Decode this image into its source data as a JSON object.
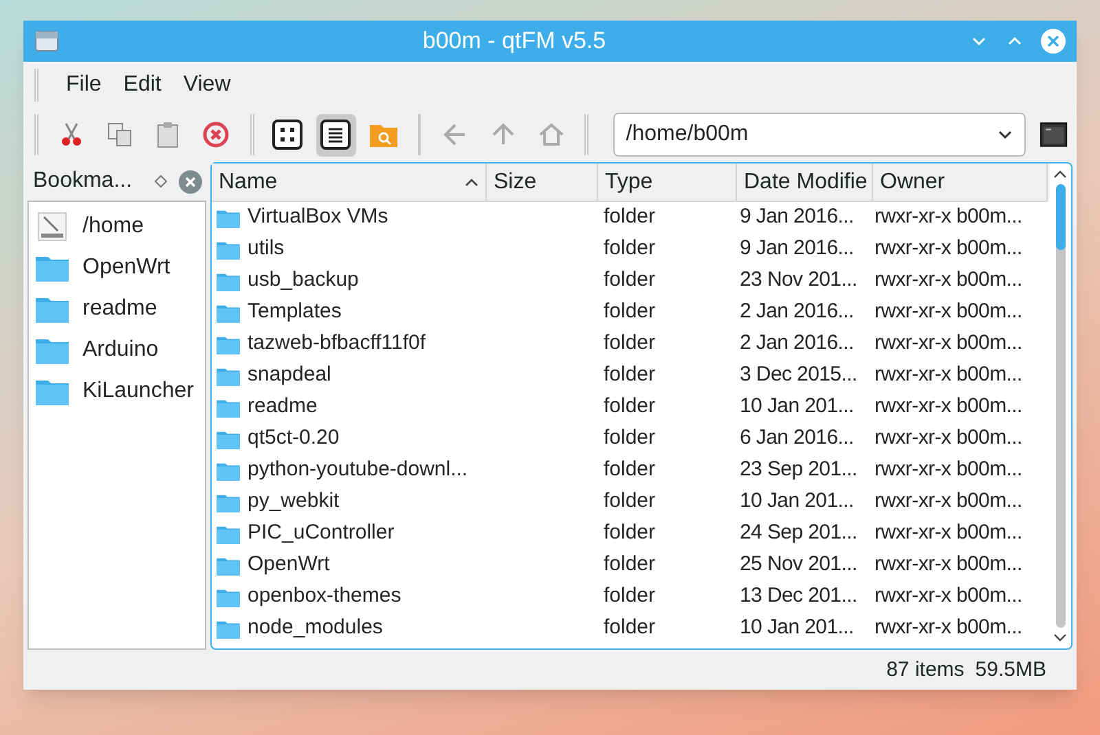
{
  "window": {
    "title": "b00m - qtFM v5.5"
  },
  "menu": [
    "File",
    "Edit",
    "View"
  ],
  "toolbar": [
    {
      "kind": "cut",
      "selected": false
    },
    {
      "kind": "copy",
      "selected": false
    },
    {
      "kind": "paste",
      "selected": false
    },
    {
      "kind": "delete",
      "selected": false
    },
    {
      "kind": "sep"
    },
    {
      "kind": "icons",
      "selected": false
    },
    {
      "kind": "details",
      "selected": true
    },
    {
      "kind": "search",
      "selected": false
    },
    {
      "kind": "sep"
    },
    {
      "kind": "back",
      "selected": false
    },
    {
      "kind": "up",
      "selected": false
    },
    {
      "kind": "home",
      "selected": false
    },
    {
      "kind": "sep"
    }
  ],
  "path": {
    "value": "/home/b00m"
  },
  "bookmarks": {
    "title": "Bookma...",
    "items": [
      {
        "label": "/home",
        "kind": "drive"
      },
      {
        "label": "OpenWrt",
        "kind": "folder"
      },
      {
        "label": "readme",
        "kind": "folder"
      },
      {
        "label": "Arduino",
        "kind": "folder"
      },
      {
        "label": "KiLauncher",
        "kind": "folder"
      }
    ]
  },
  "table": {
    "columns": [
      "Name",
      "Size",
      "Type",
      "Date Modifie",
      "Owner"
    ],
    "rows": [
      {
        "name": "VirtualBox VMs",
        "type": "folder",
        "date": "9 Jan 2016...",
        "owner": "rwxr-xr-x b00m..."
      },
      {
        "name": "utils",
        "type": "folder",
        "date": "9 Jan 2016...",
        "owner": "rwxr-xr-x b00m..."
      },
      {
        "name": "usb_backup",
        "type": "folder",
        "date": "23 Nov 201...",
        "owner": "rwxr-xr-x b00m..."
      },
      {
        "name": "Templates",
        "type": "folder",
        "date": "2 Jan 2016...",
        "owner": "rwxr-xr-x b00m..."
      },
      {
        "name": "tazweb-bfbacff11f0f",
        "type": "folder",
        "date": "2 Jan 2016...",
        "owner": "rwxr-xr-x b00m..."
      },
      {
        "name": "snapdeal",
        "type": "folder",
        "date": "3 Dec 2015...",
        "owner": "rwxr-xr-x b00m..."
      },
      {
        "name": "readme",
        "type": "folder",
        "date": "10 Jan 201...",
        "owner": "rwxr-xr-x b00m..."
      },
      {
        "name": "qt5ct-0.20",
        "type": "folder",
        "date": "6 Jan 2016...",
        "owner": "rwxr-xr-x b00m..."
      },
      {
        "name": "python-youtube-downl...",
        "type": "folder",
        "date": "23 Sep 201...",
        "owner": "rwxr-xr-x b00m..."
      },
      {
        "name": "py_webkit",
        "type": "folder",
        "date": "10 Jan 201...",
        "owner": "rwxr-xr-x b00m..."
      },
      {
        "name": "PIC_uController",
        "type": "folder",
        "date": "24 Sep 201...",
        "owner": "rwxr-xr-x b00m..."
      },
      {
        "name": "OpenWrt",
        "type": "folder",
        "date": "25 Nov 201...",
        "owner": "rwxr-xr-x b00m..."
      },
      {
        "name": "openbox-themes",
        "type": "folder",
        "date": "13 Dec 201...",
        "owner": "rwxr-xr-x b00m..."
      },
      {
        "name": "node_modules",
        "type": "folder",
        "date": "10 Jan 201...",
        "owner": "rwxr-xr-x b00m..."
      }
    ]
  },
  "status_bar": {
    "count": "87 items",
    "size": "59.5MB"
  }
}
